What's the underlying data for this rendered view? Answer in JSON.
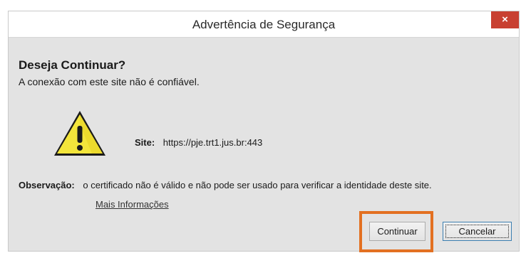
{
  "window": {
    "title": "Advertência de Segurança",
    "close_symbol": "×"
  },
  "message": {
    "heading": "Deseja Continuar?",
    "subheading": "A conexão com este site não é confiável."
  },
  "site": {
    "label": "Site:",
    "value": "https://pje.trt1.jus.br:443"
  },
  "observation": {
    "label": "Observação:",
    "value": "o certificado não é válido e não pode ser usado para verificar a identidade deste site."
  },
  "links": {
    "more_info": "Mais Informações"
  },
  "buttons": {
    "continue_label": "Continuar",
    "cancel_label": "Cancelar"
  },
  "icons": {
    "warning": "warning-icon",
    "close": "close-icon"
  },
  "colors": {
    "close_button": "#c84031",
    "highlight_border": "#e37021",
    "warning_fill": "#f3e53b"
  }
}
